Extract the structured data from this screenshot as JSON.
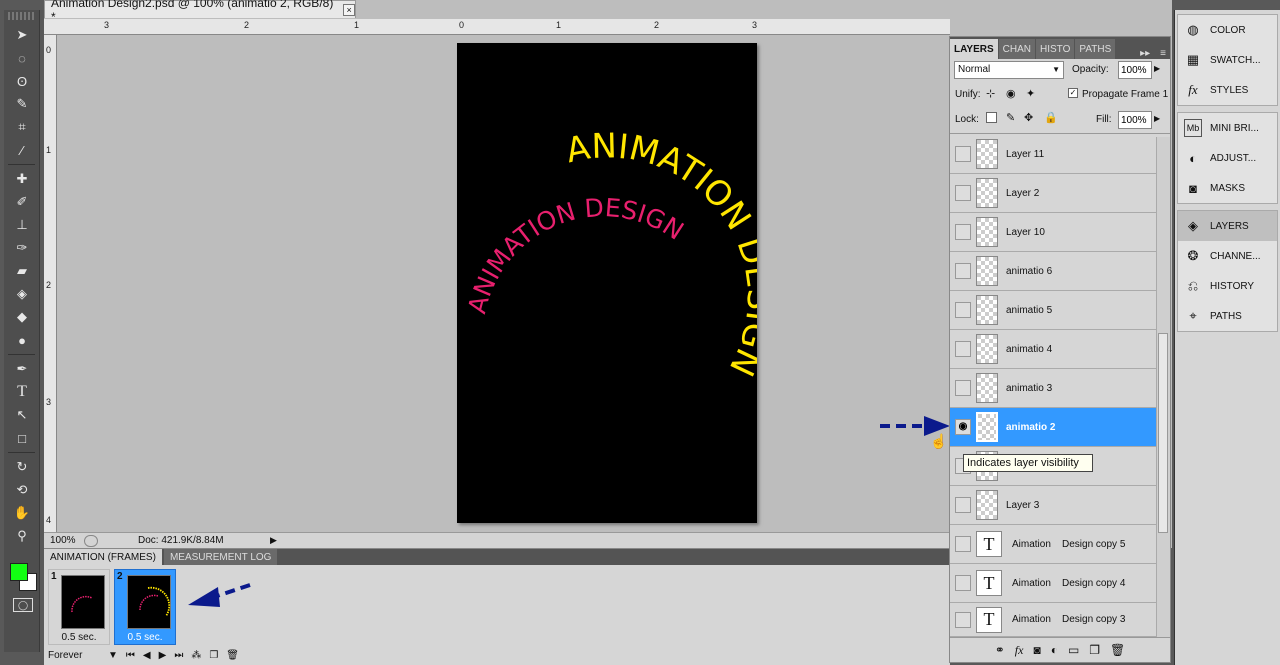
{
  "document": {
    "tab_title": "Animation Design2.psd @ 100% (animatio 2, RGB/8) *",
    "close_label": "×",
    "ruler_h_labels": [
      "3",
      "2",
      "1",
      "0",
      "1",
      "2",
      "3"
    ],
    "ruler_v_labels": [
      "0",
      "1",
      "2",
      "3",
      "4"
    ],
    "zoom": "100%",
    "doc_info": "Doc: 421.9K/8.84M",
    "canvas_text_outer": "ANIMATION DESIGN",
    "canvas_text_inner": "ANIMATION DESIGN",
    "colors": {
      "outer_text": "#ffe600",
      "inner_text": "#e8206e",
      "canvas": "#000000"
    }
  },
  "toolbar": {
    "foreground_color": "#12ff12",
    "background_color": "#ffffff",
    "tools": [
      "move-tool",
      "marquee-tool",
      "lasso-tool",
      "quick-select-tool",
      "crop-tool",
      "eyedropper-tool",
      "healing-tool",
      "brush-tool",
      "stamp-tool",
      "history-brush-tool",
      "eraser-tool",
      "gradient-tool",
      "blur-tool",
      "dodge-tool",
      "pen-tool",
      "type-tool",
      "path-select-tool",
      "shape-tool",
      "3d-rotate-tool",
      "3d-orbit-tool",
      "hand-tool",
      "zoom-tool"
    ]
  },
  "animation": {
    "tabs": [
      "ANIMATION (FRAMES)",
      "MEASUREMENT LOG"
    ],
    "frames": [
      {
        "number": "1",
        "duration": "0.5 sec."
      },
      {
        "number": "2",
        "duration": "0.5 sec."
      }
    ],
    "loop": "Forever"
  },
  "layers_panel": {
    "tabs": [
      "LAYERS",
      "CHAN",
      "HISTO",
      "PATHS"
    ],
    "blend_mode": "Normal",
    "opacity_label": "Opacity:",
    "opacity": "100%",
    "unify_label": "Unify:",
    "propagate_label": "Propagate Frame 1",
    "lock_label": "Lock:",
    "fill_label": "Fill:",
    "fill": "100%",
    "layers": [
      {
        "name": "Layer 11",
        "type": "pixel"
      },
      {
        "name": "Layer 2",
        "type": "pixel"
      },
      {
        "name": "Layer 10",
        "type": "pixel"
      },
      {
        "name": "animatio 6",
        "type": "pixel"
      },
      {
        "name": "animatio 5",
        "type": "pixel"
      },
      {
        "name": "animatio 4",
        "type": "pixel"
      },
      {
        "name": "animatio 3",
        "type": "pixel"
      },
      {
        "name": "animatio 2",
        "type": "pixel"
      },
      {
        "name": "",
        "type": "pixel"
      },
      {
        "name": "Layer 3",
        "type": "pixel"
      },
      {
        "name": "Aimation    Design copy 5",
        "type": "text"
      },
      {
        "name": "Aimation    Design copy 4",
        "type": "text"
      },
      {
        "name": "Aimation    Design copy 3",
        "type": "text"
      }
    ],
    "selected_layer": "animatio 2",
    "tooltip": "Indicates layer visibility"
  },
  "dock": {
    "group1": [
      {
        "label": "COLOR",
        "icon": "color-icon"
      },
      {
        "label": "SWATCH...",
        "icon": "swatches-icon"
      },
      {
        "label": "STYLES",
        "icon": "styles-icon"
      }
    ],
    "group2": [
      {
        "label": "MINI BRI...",
        "icon": "mini-bridge-icon"
      },
      {
        "label": "ADJUST...",
        "icon": "adjustments-icon"
      },
      {
        "label": "MASKS",
        "icon": "masks-icon"
      }
    ],
    "group3": [
      {
        "label": "LAYERS",
        "icon": "layers-icon"
      },
      {
        "label": "CHANNE...",
        "icon": "channels-icon"
      },
      {
        "label": "HISTORY",
        "icon": "history-icon"
      },
      {
        "label": "PATHS",
        "icon": "paths-icon"
      }
    ]
  }
}
